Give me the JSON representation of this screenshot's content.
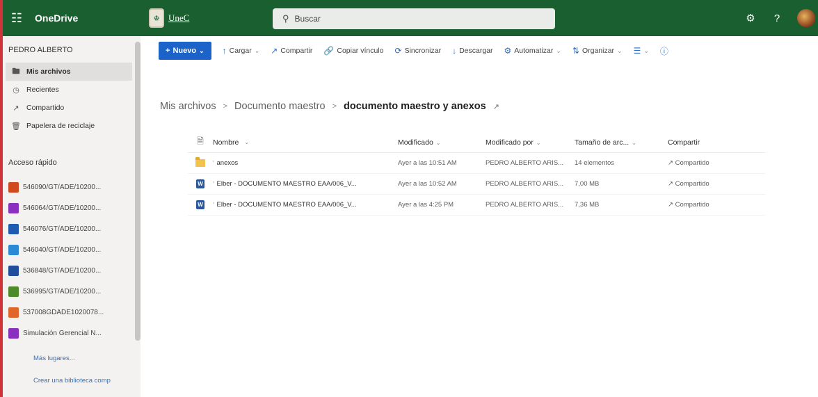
{
  "topbar": {
    "app_name": "OneDrive",
    "org_name": "UneC",
    "search_placeholder": "Buscar",
    "icons": [
      "waffle-icon",
      "settings-icon",
      "help-icon",
      "avatar"
    ]
  },
  "sidebar": {
    "user": "PEDRO ALBERTO",
    "nav": [
      {
        "label": "Mis archivos",
        "icon": "folder-icon",
        "active": true
      },
      {
        "label": "Recientes",
        "icon": "clock-icon",
        "active": false
      },
      {
        "label": "Compartido",
        "icon": "share-icon",
        "active": false
      },
      {
        "label": "Papelera de reciclaje",
        "icon": "trash-icon",
        "active": false
      }
    ],
    "quick_access_title": "Acceso rápido",
    "quick_access": [
      {
        "label": "546090/GT/ADE/10200...",
        "color": "#d04a1e"
      },
      {
        "label": "546064/GT/ADE/10200...",
        "color": "#8b2fbf"
      },
      {
        "label": "546076/GT/ADE/10200...",
        "color": "#1e5ab0"
      },
      {
        "label": "546040/GT/ADE/10200...",
        "color": "#2b8ad6"
      },
      {
        "label": "536848/GT/ADE/10200...",
        "color": "#1f4f9c"
      },
      {
        "label": "536995/GT/ADE/10200...",
        "color": "#4c8a2a"
      },
      {
        "label": "537008GDADE1020078...",
        "color": "#e0662a"
      },
      {
        "label": "Simulación Gerencial N...",
        "color": "#8b2fbf"
      }
    ],
    "more_places": "Más lugares...",
    "create_library": "Crear una biblioteca comp"
  },
  "commandbar": {
    "new_label": "Nuevo",
    "items": [
      {
        "label": "Cargar",
        "icon": "upload-icon",
        "dropdown": true
      },
      {
        "label": "Compartir",
        "icon": "share-icon",
        "dropdown": false
      },
      {
        "label": "Copiar vínculo",
        "icon": "link-icon",
        "dropdown": false
      },
      {
        "label": "Sincronizar",
        "icon": "sync-icon",
        "dropdown": false
      },
      {
        "label": "Descargar",
        "icon": "download-icon",
        "dropdown": false
      },
      {
        "label": "Automatizar",
        "icon": "automate-icon",
        "dropdown": true
      },
      {
        "label": "Organizar",
        "icon": "sort-icon",
        "dropdown": true
      }
    ]
  },
  "breadcrumb": {
    "items": [
      "Mis archivos",
      "Documento maestro"
    ],
    "current": "documento maestro y anexos"
  },
  "table": {
    "headers": {
      "name": "Nombre",
      "modified": "Modificado",
      "modified_by": "Modificado por",
      "size": "Tamaño de arc...",
      "sharing": "Compartir"
    },
    "rows": [
      {
        "type": "folder",
        "name": "anexos",
        "modified": "Ayer a las 10:51 AM",
        "modified_by": "PEDRO ALBERTO ARIS...",
        "size": "14 elementos",
        "sharing": "Compartido"
      },
      {
        "type": "word",
        "name": "Elber - DOCUMENTO MAESTRO EAA/006_V...",
        "modified": "Ayer a las 10:52 AM",
        "modified_by": "PEDRO ALBERTO ARIS...",
        "size": "7,00 MB",
        "sharing": "Compartido"
      },
      {
        "type": "word",
        "name": "Elber - DOCUMENTO MAESTRO EAA/006_V...",
        "modified": "Ayer a las 4:25 PM",
        "modified_by": "PEDRO ALBERTO ARIS...",
        "size": "7,36 MB",
        "sharing": "Compartido"
      }
    ]
  }
}
